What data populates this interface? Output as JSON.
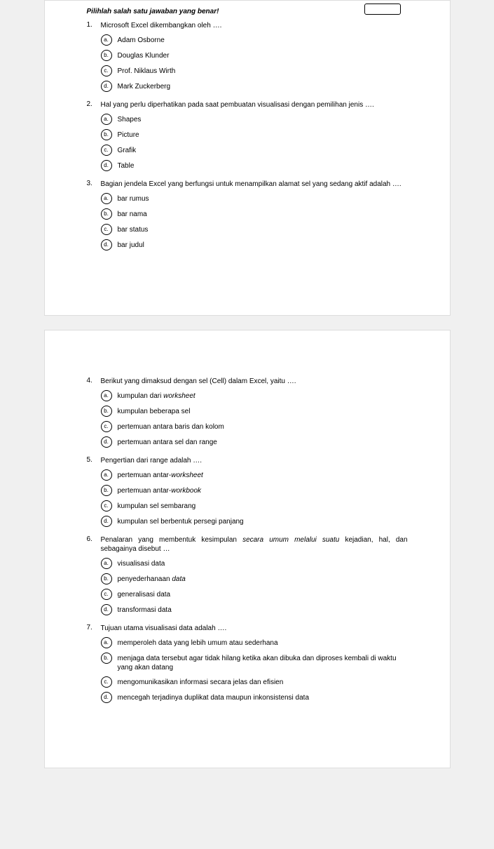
{
  "instruction": "Pilihlah salah satu jawaban yang benar!",
  "questions": [
    {
      "num": "1.",
      "text": "Microsoft Excel dikembangkan oleh ….",
      "options": [
        {
          "k": "a.",
          "t": "Adam Osborne"
        },
        {
          "k": "b.",
          "t": "Douglas Klunder"
        },
        {
          "k": "c.",
          "t": "Prof. Niklaus Wirth"
        },
        {
          "k": "d.",
          "t": "Mark Zuckerberg"
        }
      ]
    },
    {
      "num": "2.",
      "text": "Hal yang perlu diperhatikan pada saat pembuatan visualisasi dengan pemilihan jenis ….",
      "options": [
        {
          "k": "a.",
          "t": "Shapes"
        },
        {
          "k": "b.",
          "t": "Picture"
        },
        {
          "k": "c.",
          "t": "Grafik"
        },
        {
          "k": "d.",
          "t": "Table"
        }
      ]
    },
    {
      "num": "3.",
      "text": "Bagian jendela Excel yang berfungsi untuk menampilkan alamat sel yang sedang aktif adalah ….",
      "options": [
        {
          "k": "a.",
          "t": "bar rumus"
        },
        {
          "k": "b.",
          "t": "bar nama"
        },
        {
          "k": "c.",
          "t": "bar status"
        },
        {
          "k": "d.",
          "t": "bar judul"
        }
      ]
    },
    {
      "num": "4.",
      "text": "Berikut yang dimaksud dengan sel (Cell) dalam Excel, yaitu ….",
      "options": [
        {
          "k": "a.",
          "t": "kumpulan dari worksheet",
          "italic": [
            "worksheet"
          ]
        },
        {
          "k": "b.",
          "t": "kumpulan beberapa sel"
        },
        {
          "k": "c.",
          "t": "pertemuan antara baris dan kolom"
        },
        {
          "k": "d.",
          "t": "pertemuan antara sel dan range"
        }
      ]
    },
    {
      "num": "5.",
      "text": "Pengertian dari range adalah ….",
      "options": [
        {
          "k": "a.",
          "t": "pertemuan antar-worksheet",
          "italic": [
            "worksheet"
          ]
        },
        {
          "k": "b.",
          "t": "pertemuan antar-workbook",
          "italic": [
            "workbook"
          ]
        },
        {
          "k": "c.",
          "t": "kumpulan sel sembarang"
        },
        {
          "k": "d.",
          "t": "kumpulan sel berbentuk persegi panjang"
        }
      ]
    },
    {
      "num": "6.",
      "text": "Penalaran yang membentuk kesimpulan secara umum melalui suatu kejadian, hal, dan sebagainya disebut …",
      "text_italic": [
        "secara umum melalui suatu"
      ],
      "options": [
        {
          "k": "a.",
          "t": "visualisasi data"
        },
        {
          "k": "b.",
          "t": "penyederhanaan data",
          "italic": [
            "data"
          ]
        },
        {
          "k": "c.",
          "t": "generalisasi data"
        },
        {
          "k": "d.",
          "t": "transformasi data"
        }
      ]
    },
    {
      "num": "7.",
      "text": "Tujuan utama visualisasi data adalah ….",
      "options": [
        {
          "k": "a.",
          "t": "memperoleh data yang lebih umum atau sederhana"
        },
        {
          "k": "b.",
          "t": "menjaga data tersebut agar tidak hilang ketika akan dibuka dan diproses kembali di waktu yang akan datang"
        },
        {
          "k": "c.",
          "t": "mengomunikasikan informasi secara jelas dan efisien"
        },
        {
          "k": "d.",
          "t": "mencegah terjadinya duplikat data maupun inkonsistensi data"
        }
      ]
    }
  ],
  "page_split_after": 3
}
